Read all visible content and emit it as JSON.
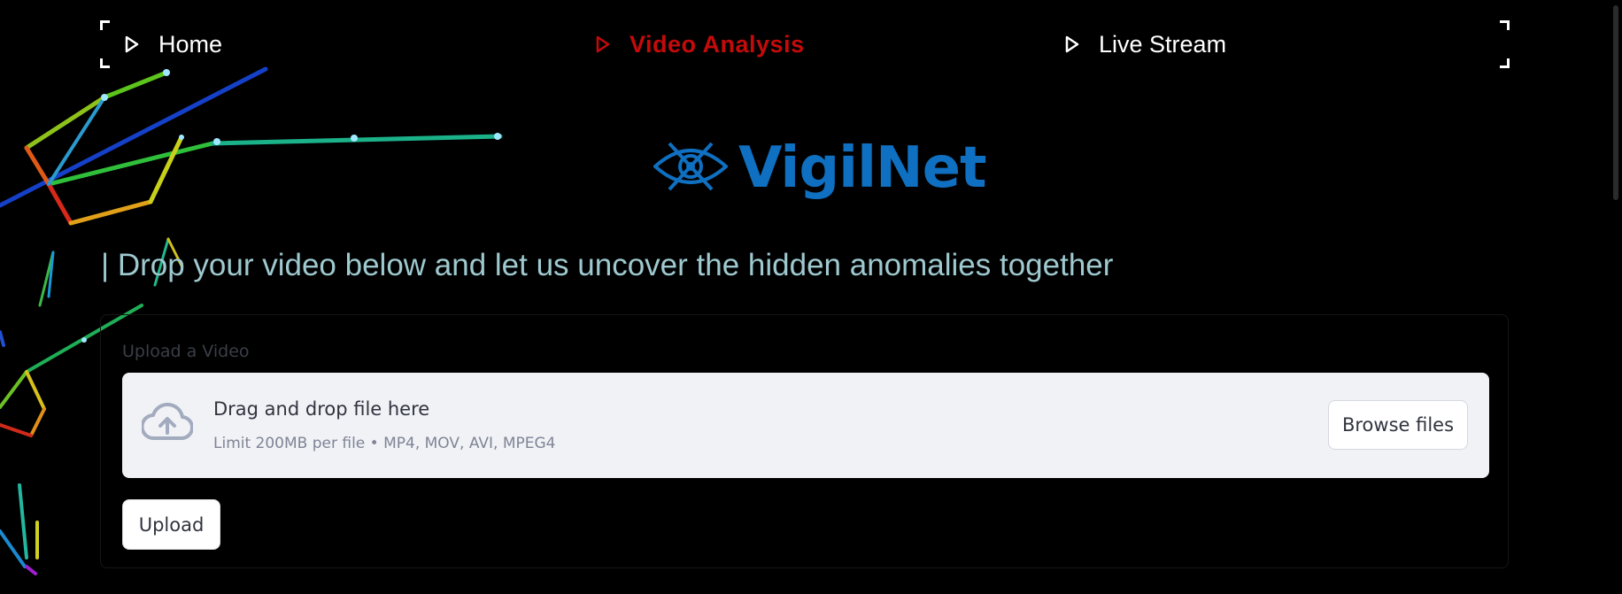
{
  "nav": {
    "items": [
      {
        "label": "Home",
        "icon": "play-outline-icon",
        "active": false
      },
      {
        "label": "Video Analysis",
        "icon": "play-outline-icon",
        "active": true
      },
      {
        "label": "Live Stream",
        "icon": "play-outline-icon",
        "active": false
      }
    ],
    "active_color": "#c40a0a"
  },
  "logo": {
    "text": "VigilNet",
    "icon": "eye-icon",
    "color": "#0f6fc0"
  },
  "tagline": "| Drop your video below and let us uncover the hidden anomalies together",
  "upload": {
    "label": "Upload a Video",
    "dropzone_title": "Drag and drop file here",
    "dropzone_subtitle": "Limit 200MB per file • MP4, MOV, AVI, MPEG4",
    "browse_label": "Browse files",
    "upload_label": "Upload",
    "cloud_icon": "cloud-upload-icon"
  },
  "background": {
    "decoration": "pose-skeleton-graphic"
  }
}
